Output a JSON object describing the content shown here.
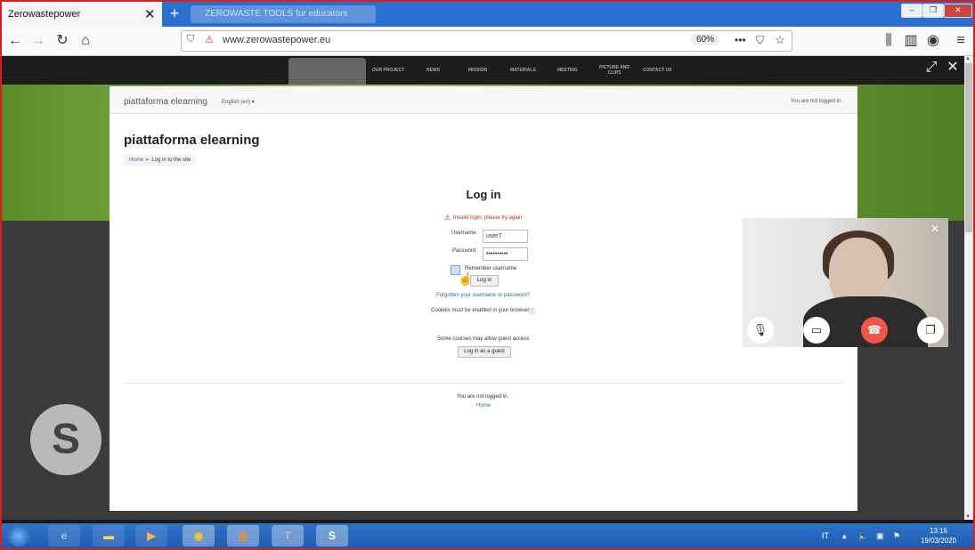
{
  "browser": {
    "tab_title": "Zerowastepower",
    "background_tab_label": "ZEROWASTE TOOLS for educators",
    "url": "www.zerowastepower.eu",
    "zoom": "60%"
  },
  "site_menu": {
    "items": [
      "OUR PROJECT",
      "NEWS",
      "MISSION",
      "MATERIALS",
      "MEETING",
      "PICTURE AND CLIPS",
      "CONTACT US"
    ]
  },
  "moodle": {
    "brand": "piattaforma elearning",
    "language": "English (en) ▾",
    "not_logged_top": "You are not logged in.",
    "page_heading": "piattaforma elearning",
    "breadcrumb_home": "Home",
    "breadcrumb_sep": "►",
    "breadcrumb_current": "Log in to the site",
    "login_title": "Log in",
    "error_text": "Invalid login, please try again",
    "username_label": "Username",
    "username_value": "user7",
    "password_label": "Password",
    "password_value": "••••••••••",
    "remember_label": "Remember username",
    "login_button": "Log in",
    "forgot_link": "Forgotten your username or password?",
    "cookies_text": "Cookies must be enabled in your browser",
    "guest_text": "Some courses may allow guest access",
    "guest_button": "Log in as a guest",
    "footer_not_logged": "You are not logged in.",
    "footer_home": "Home"
  },
  "taskbar": {
    "language": "IT",
    "time": "13:16",
    "date": "19/03/2020"
  },
  "colors": {
    "accent_tab_strip": "#2a6fd0",
    "error": "#b12b2b",
    "link": "#2a6aa8",
    "end_call": "#f0564a",
    "frame_border": "#d32020"
  }
}
